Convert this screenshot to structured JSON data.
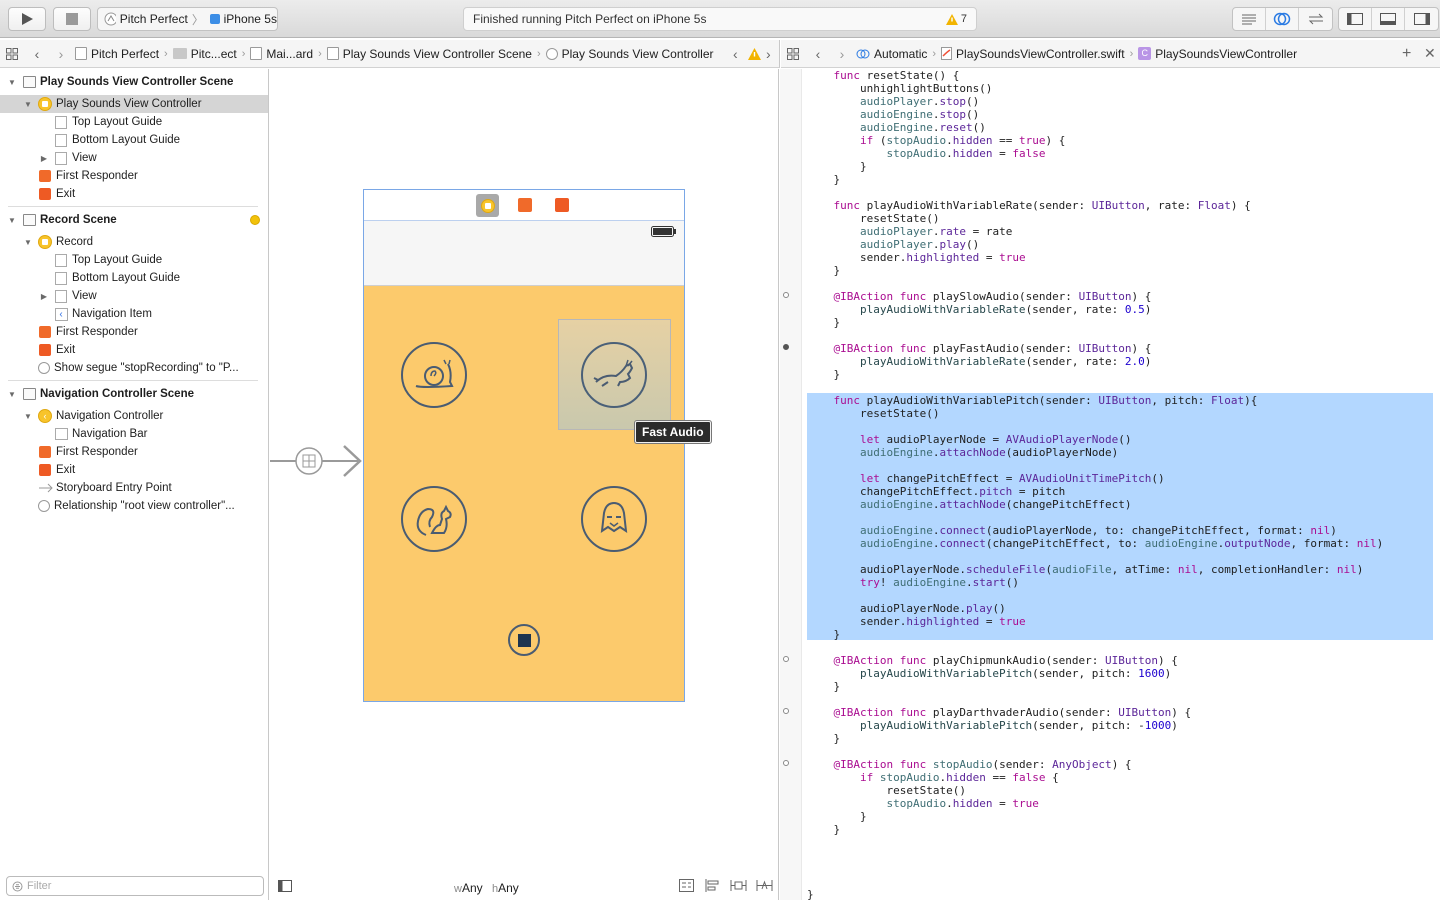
{
  "toolbar": {
    "scheme_project": "Pitch Perfect",
    "scheme_device": "iPhone 5s",
    "status_text": "Finished running Pitch Perfect on iPhone 5s",
    "warning_count": "7"
  },
  "left_jumpbar": {
    "items": [
      "Pitch Perfect",
      "Pitc...ect",
      "Mai...ard",
      "Play Sounds View Controller Scene",
      "Play Sounds View Controller"
    ]
  },
  "right_jumpbar": {
    "items": [
      "Automatic",
      "PlaySoundsViewController.swift",
      "PlaySoundsViewController"
    ]
  },
  "outline": {
    "rows": [
      {
        "label": "Play Sounds View Controller Scene"
      },
      {
        "label": "Play Sounds View Controller"
      },
      {
        "label": "Top Layout Guide"
      },
      {
        "label": "Bottom Layout Guide"
      },
      {
        "label": "View"
      },
      {
        "label": "First Responder"
      },
      {
        "label": "Exit"
      },
      {
        "label": "Record Scene"
      },
      {
        "label": "Record"
      },
      {
        "label": "Top Layout Guide"
      },
      {
        "label": "Bottom Layout Guide"
      },
      {
        "label": "View"
      },
      {
        "label": "Navigation Item"
      },
      {
        "label": "First Responder"
      },
      {
        "label": "Exit"
      },
      {
        "label": "Show segue \"stopRecording\" to \"P..."
      },
      {
        "label": "Navigation Controller Scene"
      },
      {
        "label": "Navigation Controller"
      },
      {
        "label": "Navigation Bar"
      },
      {
        "label": "First Responder"
      },
      {
        "label": "Exit"
      },
      {
        "label": "Storyboard Entry Point"
      },
      {
        "label": "Relationship \"root view controller\"..."
      }
    ],
    "filter_placeholder": "Filter"
  },
  "canvas": {
    "tooltip": "Fast Audio",
    "size_w_prefix": "w",
    "size_w": "Any",
    "size_h_prefix": "h",
    "size_h": "Any"
  },
  "code": {
    "lines": [
      "    func resetState() {",
      "        unhighlightButtons()",
      "        audioPlayer.stop()",
      "        audioEngine.stop()",
      "        audioEngine.reset()",
      "        if (stopAudio.hidden == true) {",
      "            stopAudio.hidden = false",
      "        }",
      "    }",
      "",
      "    func playAudioWithVariableRate(sender: UIButton, rate: Float) {",
      "        resetState()",
      "        audioPlayer.rate = rate",
      "        audioPlayer.play()",
      "        sender.highlighted = true",
      "    }",
      "",
      "    @IBAction func playSlowAudio(sender: UIButton) {",
      "        playAudioWithVariableRate(sender, rate: 0.5)",
      "    }",
      "",
      "    @IBAction func playFastAudio(sender: UIButton) {",
      "        playAudioWithVariableRate(sender, rate: 2.0)",
      "    }",
      "",
      "    func playAudioWithVariablePitch(sender: UIButton, pitch: Float){",
      "        resetState()",
      "",
      "        let audioPlayerNode = AVAudioPlayerNode()",
      "        audioEngine.attachNode(audioPlayerNode)",
      "",
      "        let changePitchEffect = AVAudioUnitTimePitch()",
      "        changePitchEffect.pitch = pitch",
      "        audioEngine.attachNode(changePitchEffect)",
      "",
      "        audioEngine.connect(audioPlayerNode, to: changePitchEffect, format: nil)",
      "        audioEngine.connect(changePitchEffect, to: audioEngine.outputNode, format: nil)",
      "",
      "        audioPlayerNode.scheduleFile(audioFile, atTime: nil, completionHandler: nil)",
      "        try! audioEngine.start()",
      "",
      "        audioPlayerNode.play()",
      "        sender.highlighted = true",
      "    }",
      "",
      "    @IBAction func playChipmunkAudio(sender: UIButton) {",
      "        playAudioWithVariablePitch(sender, pitch: 1600)",
      "    }",
      "",
      "    @IBAction func playDarthvaderAudio(sender: UIButton) {",
      "        playAudioWithVariablePitch(sender, pitch: -1000)",
      "    }",
      "",
      "    @IBAction func stopAudio(sender: AnyObject) {",
      "        if stopAudio.hidden == false {",
      "            resetState()",
      "            stopAudio.hidden = true",
      "        }",
      "    }",
      "",
      "",
      "",
      "",
      "}"
    ]
  },
  "colors": {
    "view_background": "#fcca6c",
    "selection": "#b3d7ff",
    "keyword": "#aa0d91",
    "type": "#5c2699"
  }
}
